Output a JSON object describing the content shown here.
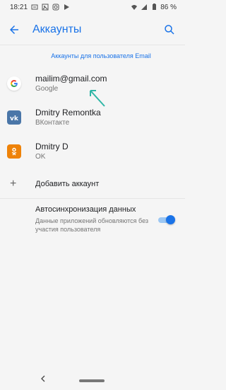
{
  "status": {
    "time": "18:21",
    "battery": "86 %"
  },
  "app": {
    "title": "Аккаунты"
  },
  "section": {
    "header": "Аккаунты для пользователя Email"
  },
  "accounts": [
    {
      "name": "mailim@gmail.com",
      "type": "Google",
      "icon": "google-icon"
    },
    {
      "name": "Dmitry Remontka",
      "type": "ВКонтакте",
      "icon": "vk-icon"
    },
    {
      "name": "Dmitry D",
      "type": "OK",
      "icon": "ok-icon"
    }
  ],
  "add": {
    "label": "Добавить аккаунт"
  },
  "sync": {
    "title": "Автосинхронизация данных",
    "description": "Данные приложений обновляются без участия пользователя",
    "enabled": true
  },
  "colors": {
    "accent": "#1a73e8",
    "vk": "#4a76a8",
    "ok": "#ee8208"
  }
}
